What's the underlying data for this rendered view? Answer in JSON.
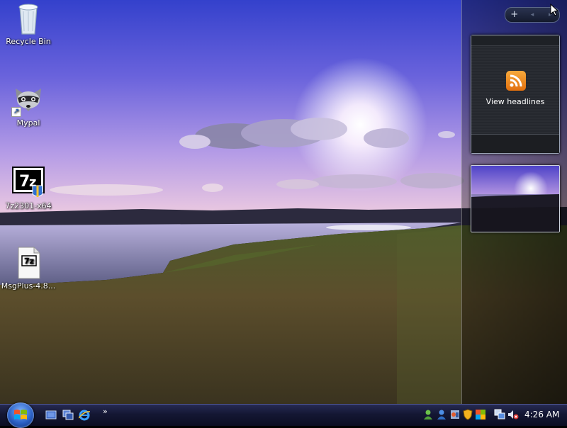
{
  "desktop": {
    "icons": [
      {
        "label": "Recycle Bin",
        "icon": "recycle-bin-icon"
      },
      {
        "label": "Mypal",
        "icon": "mypal-raccoon-icon"
      },
      {
        "label": "7z2301-x64",
        "icon": "7zip-installer-icon"
      },
      {
        "label": "MsgPlus-4.8...",
        "icon": "7z-archive-file-icon"
      }
    ]
  },
  "sidebar": {
    "controls": {
      "add": "+",
      "prev": "◂",
      "next": "▸"
    },
    "feed_gadget": {
      "label": "View headlines",
      "icon": "rss-feed-icon"
    },
    "slideshow_gadget": {
      "icon": "slideshow-thumbnail"
    }
  },
  "taskbar": {
    "start_icon": "windows-orb-icon",
    "quick_launch": [
      "show-desktop-icon",
      "switch-windows-icon",
      "internet-explorer-icon"
    ],
    "quick_launch_more": "»",
    "tray_icons": [
      "messenger-contact-icon",
      "messenger-contact-icon-2",
      "network-agent-icon",
      "security-shield-icon",
      "windows-update-icon",
      "network-icon",
      "volume-muted-icon"
    ],
    "clock": "4:26 AM"
  },
  "colors": {
    "sky_top": "#3d4bd2",
    "sky_mid": "#8c7ee0",
    "horizon": "#e8c7e3",
    "taskbar": "#141733",
    "rss_orange": "#f08a1e"
  }
}
